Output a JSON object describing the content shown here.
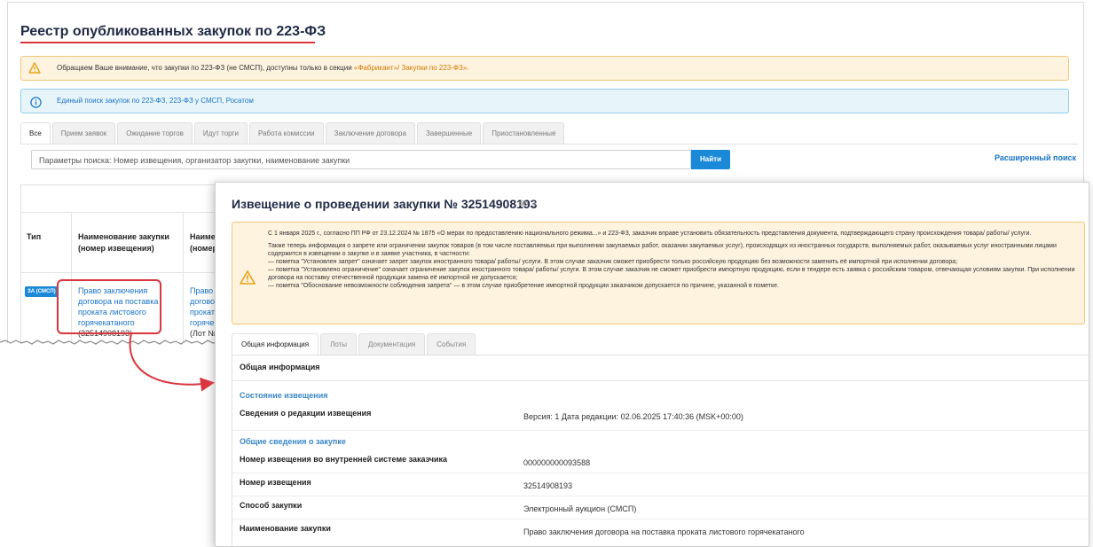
{
  "colors": {
    "accent_red": "#d9363e",
    "link_blue": "#1a73c7",
    "warn_bg": "#fdf3df",
    "info_bg": "#e7f5fb",
    "primary_btn": "#1a8ad8"
  },
  "registry": {
    "title": "Реестр опубликованных закупок по 223-ФЗ",
    "warning": {
      "text": "Обращаем Ваше внимание, что закупки по 223-ФЗ (не СМСП), доступны только в секции",
      "link": "«Фабрикант»/ Закупки по 223-ФЗ».",
      "icon": "warning-triangle-icon"
    },
    "info": {
      "text": "Единый поиск закупок по 223-ФЗ, 223-ФЗ у СМСП, Росатом",
      "icon": "info-circle-icon"
    },
    "tabs": [
      "Все",
      "Прием заявок",
      "Ожидание торгов",
      "Идут торги",
      "Работа комиссии",
      "Заключение договора",
      "Завершенные",
      "Приостановленные"
    ],
    "search": {
      "placeholder": "Параметры поиска: Номер извещения, организатор закупки, наименование закупки",
      "button": "Найти",
      "advanced": "Расширенный поиск"
    },
    "table": {
      "headers": {
        "type": "Тип",
        "name": "Наименование закупки (номер извещения)",
        "lot": "Наименов (номер ло"
      },
      "row": {
        "badge": "ЗА (СМСП)",
        "name_link": "Право заключения договора на поставка проката листового горячекатаного",
        "notice_number": "(32514908193)",
        "lot_link": "Право зак договора проката л горячекат",
        "lot_number": "(Лот №1)"
      }
    }
  },
  "notice": {
    "title": "Извещение о проведении закупки № 32514908193",
    "views": "3",
    "alert": {
      "icon": "warning-triangle-icon",
      "p1": "С 1 января 2025 г., согласно ПП РФ от 23.12.2024 № 1875 «О мерах по предоставлению национального режима...» и 223-ФЗ, заказчик вправе установить обязательность представления документа, подтверждающего страну происхождения товара/ работы/ услуги.",
      "p2": "Также теперь информация о запрете или ограничении закупок товаров (в том числе поставляемых при выполнении закупаемых работ, оказании закупаемых услуг), происходящих из иностранных государств, выполняемых работ, оказываемых услуг иностранными лицами содержится в извещении о закупке и в заявке участника, в частности:",
      "p3": "— пометка \"Установлен запрет\" означает запрет закупок иностранного товара/ работы/ услуги. В этом случае заказчик сможет приобрести только российскую продукцию без возможности заменить её импортной при исполнении договора;",
      "p4": "— пометка \"Установлено ограничение\" означает ограничение закупок иностранного товара/ работы/ услуги. В этом случае заказчик не сможет приобрести импортную продукцию, если в тендере есть заявка с российским товаром, отвечающая условиям закупки. При исполнении договора на поставку отечественной продукции замена её импортной не допускается;",
      "p5": "— пометка \"Обоснование невозможности соблюдения запрета\" — в этом случае приобретение импортной продукции заказчиком допускается по причине, указанной в пометке."
    },
    "tabs": [
      "Общая информация",
      "Лоты",
      "Документация",
      "События"
    ],
    "section_title": "Общая информация",
    "state_heading": "Состояние извещения",
    "general_heading": "Общие сведения о закупке",
    "fields": [
      {
        "label": "Сведения о редакции извещения",
        "value": "Версия: 1 Дата редакции: 02.06.2025 17:40:36 (MSK+00:00)"
      },
      {
        "label": "Номер извещения во внутренней системе заказчика",
        "value": "000000000093588"
      },
      {
        "label": "Номер извещения",
        "value": "32514908193"
      },
      {
        "label": "Способ закупки",
        "value": "Электронный аукцион (СМСП)"
      },
      {
        "label": "Наименование закупки",
        "value": "Право заключения договора на поставка проката листового горячекатаного"
      }
    ]
  }
}
